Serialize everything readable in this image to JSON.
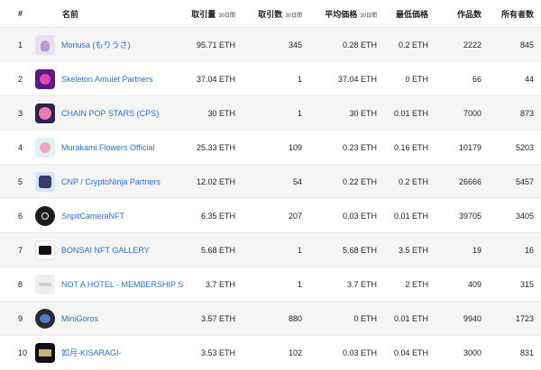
{
  "headers": {
    "rank": "#",
    "name": "名前",
    "volume": "取引量",
    "volume_sub": "30日間",
    "sales": "取引数",
    "sales_sub": "30日間",
    "avg_price": "平均価格",
    "avg_price_sub": "30日間",
    "floor": "最低価格",
    "items": "作品数",
    "owners": "所有者数"
  },
  "rows": [
    {
      "rank": "1",
      "name": "Moriusa (もりうさ)",
      "volume": "95.71 ETH",
      "sales": "345",
      "avg": "0.28 ETH",
      "floor": "0.2 ETH",
      "items": "2222",
      "owners": "845"
    },
    {
      "rank": "2",
      "name": "Skeleton Amulet Partners",
      "volume": "37.04 ETH",
      "sales": "1",
      "avg": "37.04 ETH",
      "floor": "0 ETH",
      "items": "66",
      "owners": "44"
    },
    {
      "rank": "3",
      "name": "CHAIN POP STARS (CPS)",
      "volume": "30 ETH",
      "sales": "1",
      "avg": "30 ETH",
      "floor": "0.01 ETH",
      "items": "7000",
      "owners": "873"
    },
    {
      "rank": "4",
      "name": "Murakami.Flowers Official",
      "volume": "25.33 ETH",
      "sales": "109",
      "avg": "0.23 ETH",
      "floor": "0.16 ETH",
      "items": "10179",
      "owners": "5203"
    },
    {
      "rank": "5",
      "name": "CNP / CryptoNinja Partners",
      "volume": "12.02 ETH",
      "sales": "54",
      "avg": "0.22 ETH",
      "floor": "0.2 ETH",
      "items": "26666",
      "owners": "5457"
    },
    {
      "rank": "6",
      "name": "SnpitCameraNFT",
      "volume": "6.35 ETH",
      "sales": "207",
      "avg": "0.03 ETH",
      "floor": "0.01 ETH",
      "items": "39705",
      "owners": "3405"
    },
    {
      "rank": "7",
      "name": "BONSAI NFT GALLERY",
      "volume": "5.68 ETH",
      "sales": "1",
      "avg": "5.68 ETH",
      "floor": "3.5 ETH",
      "items": "19",
      "owners": "16"
    },
    {
      "rank": "8",
      "name": "NOT A HOTEL - MEMBERSHIP S",
      "volume": "3.7 ETH",
      "sales": "1",
      "avg": "3.7 ETH",
      "floor": "2 ETH",
      "items": "409",
      "owners": "315"
    },
    {
      "rank": "9",
      "name": "MiniGoros",
      "volume": "3.57 ETH",
      "sales": "880",
      "avg": "0 ETH",
      "floor": "0.01 ETH",
      "items": "9940",
      "owners": "1723"
    },
    {
      "rank": "10",
      "name": "如月-KISARAGI-",
      "volume": "3.53 ETH",
      "sales": "102",
      "avg": "0.03 ETH",
      "floor": "0.04 ETH",
      "items": "3000",
      "owners": "831"
    }
  ]
}
